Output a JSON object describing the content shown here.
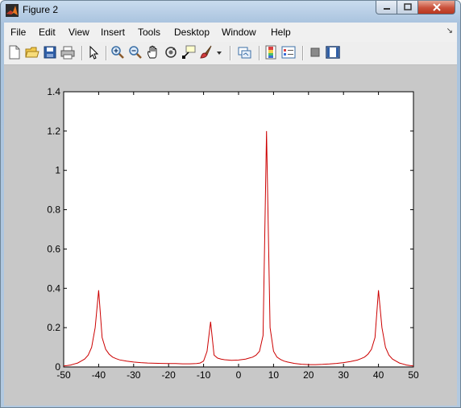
{
  "window": {
    "title": "Figure 2"
  },
  "menu": {
    "items": [
      "File",
      "Edit",
      "View",
      "Insert",
      "Tools",
      "Desktop",
      "Window",
      "Help"
    ]
  },
  "toolbar": {
    "icons": [
      "new-figure-icon",
      "open-file-icon",
      "save-icon",
      "print-icon",
      "edit-plot-icon",
      "zoom-in-icon",
      "zoom-out-icon",
      "pan-icon",
      "rotate-3d-icon",
      "data-cursor-icon",
      "brush-icon",
      "link-plot-icon",
      "insert-colorbar-icon",
      "insert-legend-icon",
      "hide-plot-tools-icon",
      "show-plot-tools-icon"
    ]
  },
  "colors": {
    "line": "#cc0000",
    "figure_bg": "#c8c8c8",
    "axes_bg": "#ffffff"
  },
  "chart_data": {
    "type": "line",
    "title": "",
    "xlabel": "",
    "ylabel": "",
    "xlim": [
      -50,
      50
    ],
    "ylim": [
      0,
      1.4
    ],
    "xticks": [
      "-50",
      "-40",
      "-30",
      "-20",
      "-10",
      "0",
      "10",
      "20",
      "30",
      "40",
      "50"
    ],
    "yticks": [
      "0",
      "0.2",
      "0.4",
      "0.6",
      "0.8",
      "1",
      "1.2",
      "1.4"
    ],
    "grid": false,
    "series": [
      {
        "color": "#cc0000",
        "x": [
          -50,
          -49,
          -48,
          -47,
          -46,
          -45,
          -44,
          -43,
          -42,
          -41,
          -40,
          -39,
          -38,
          -37,
          -36,
          -35,
          -34,
          -32,
          -30,
          -28,
          -26,
          -24,
          -22,
          -20,
          -18,
          -16,
          -14,
          -12,
          -11,
          -10,
          -9,
          -8,
          -7,
          -6,
          -5,
          -4,
          -3,
          -2,
          0,
          2,
          3,
          4,
          5,
          6,
          7,
          8,
          9,
          10,
          11,
          12,
          13,
          14,
          16,
          18,
          20,
          22,
          24,
          26,
          28,
          30,
          32,
          34,
          35,
          36,
          37,
          38,
          39,
          40,
          41,
          42,
          43,
          44,
          45,
          46,
          47,
          48,
          49,
          50
        ],
        "y": [
          0.005,
          0.007,
          0.01,
          0.015,
          0.02,
          0.03,
          0.04,
          0.06,
          0.1,
          0.2,
          0.39,
          0.15,
          0.09,
          0.065,
          0.05,
          0.042,
          0.036,
          0.03,
          0.025,
          0.022,
          0.02,
          0.019,
          0.018,
          0.017,
          0.017,
          0.016,
          0.016,
          0.017,
          0.02,
          0.03,
          0.08,
          0.23,
          0.06,
          0.045,
          0.04,
          0.037,
          0.035,
          0.034,
          0.035,
          0.04,
          0.045,
          0.05,
          0.06,
          0.08,
          0.16,
          1.2,
          0.2,
          0.08,
          0.05,
          0.038,
          0.03,
          0.025,
          0.018,
          0.014,
          0.012,
          0.012,
          0.013,
          0.015,
          0.018,
          0.022,
          0.028,
          0.035,
          0.042,
          0.05,
          0.065,
          0.09,
          0.15,
          0.39,
          0.2,
          0.1,
          0.06,
          0.04,
          0.03,
          0.02,
          0.015,
          0.01,
          0.007,
          0.005
        ]
      }
    ]
  }
}
